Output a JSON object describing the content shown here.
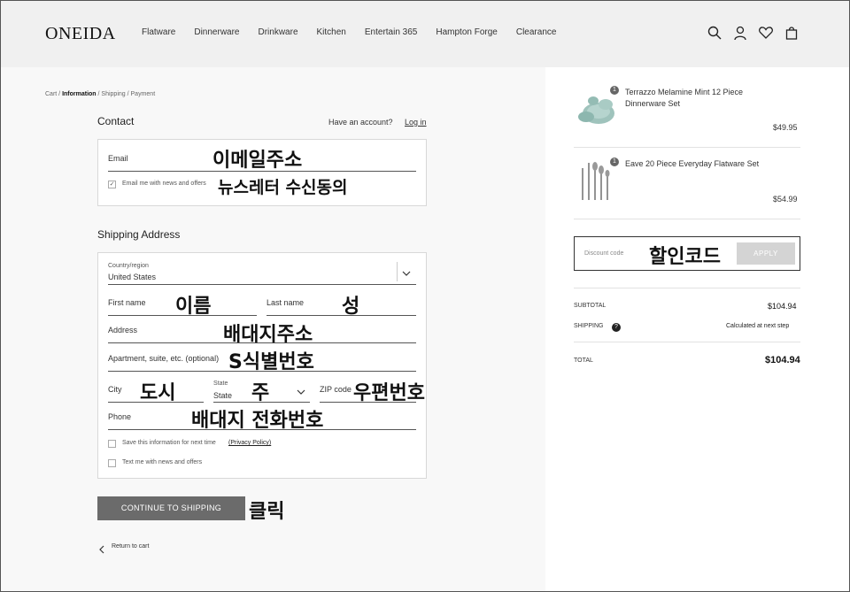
{
  "header": {
    "logo": "ONEIDA",
    "nav": [
      "Flatware",
      "Dinnerware",
      "Drinkware",
      "Kitchen",
      "Entertain 365",
      "Hampton Forge",
      "Clearance"
    ],
    "icons": [
      "search-icon",
      "account-icon",
      "wishlist-icon",
      "bag-icon"
    ]
  },
  "breadcrumb": {
    "cart": "Cart",
    "information": "Information",
    "shipping": "Shipping",
    "payment": "Payment",
    "sep": " / "
  },
  "contact": {
    "title": "Contact",
    "have_account": "Have an account?",
    "login": "Log in",
    "email_label": "Email",
    "email_note": "이메일주소",
    "news_label": "Email me with news and offers",
    "news_note": "뉴스레터 수신동의"
  },
  "shipping_address": {
    "title": "Shipping Address",
    "country_label": "Country/region",
    "country_value": "United States",
    "first_name": "First name",
    "first_name_note": "이름",
    "last_name": "Last name",
    "last_name_note": "성",
    "address": "Address",
    "address_note": "배대지주소",
    "apartment": "Apartment, suite, etc. (optional)",
    "apartment_note": "S식별번호",
    "city": "City",
    "city_note": "도시",
    "state_label": "State",
    "state_value": "State",
    "state_note": "주",
    "zip": "ZIP code",
    "zip_note": "우편번호",
    "phone": "Phone",
    "phone_note": "배대지 전화번호",
    "save_info": "Save this information for next time",
    "privacy": "(Privacy Policy)",
    "text_me": "Text me with news and offers"
  },
  "actions": {
    "continue": "CONTINUE TO SHIPPING",
    "continue_note": "클릭",
    "return": "Return to cart"
  },
  "order": {
    "items": [
      {
        "qty": "1",
        "name": "Terrazzo Melamine Mint 12 Piece Dinnerware Set",
        "price": "$49.95"
      },
      {
        "qty": "1",
        "name": "Eave 20 Piece Everyday Flatware Set",
        "price": "$54.99"
      }
    ],
    "discount_placeholder": "Discount code",
    "discount_note": "할인코드",
    "apply": "APPLY",
    "subtotal_label": "SUBTOTAL",
    "subtotal_value": "$104.94",
    "shipping_label": "SHIPPING",
    "shipping_value": "Calculated at next step",
    "total_label": "TOTAL",
    "total_value": "$104.94"
  },
  "colors": {
    "header_bg": "#f0f0f0",
    "button_bg": "#6b6b6b",
    "apply_bg": "#d4d4d4"
  }
}
